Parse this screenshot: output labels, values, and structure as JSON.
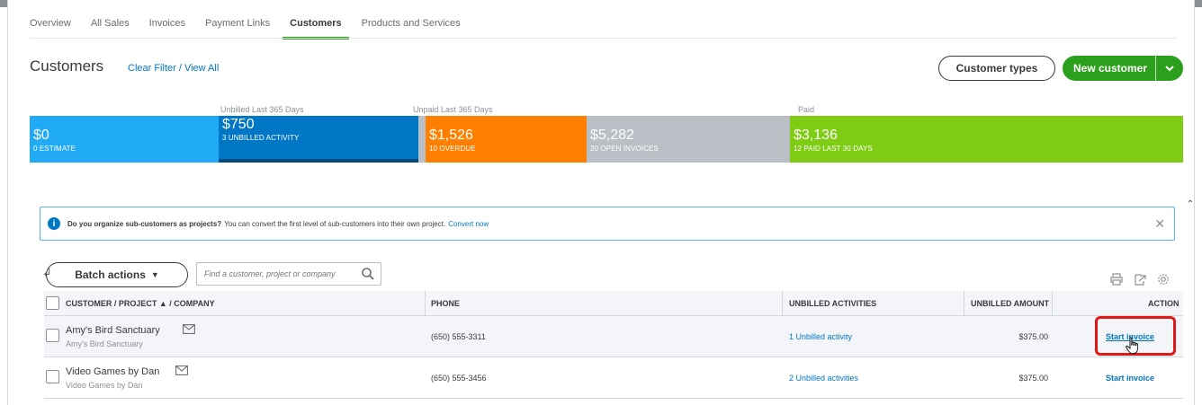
{
  "tabs": [
    "Overview",
    "All Sales",
    "Invoices",
    "Payment Links",
    "Customers",
    "Products and Services"
  ],
  "active_tab": "Customers",
  "header": {
    "title": "Customers",
    "clear_filter": "Clear Filter / View All",
    "customer_types_button": "Customer types",
    "new_customer_button": "New customer"
  },
  "money_bar": {
    "captions": {
      "unbilled": "Unbilled Last 365 Days",
      "unpaid": "Unpaid Last 365 Days",
      "paid": "Paid"
    },
    "segments": {
      "estimate": {
        "amount": "$0",
        "label": "0 ESTIMATE"
      },
      "unbilled": {
        "amount": "$750",
        "label": "3 UNBILLED ACTIVITY"
      },
      "overdue": {
        "amount": "$1,526",
        "label": "10 OVERDUE"
      },
      "open": {
        "amount": "$5,282",
        "label": "20 OPEN INVOICES"
      },
      "paid": {
        "amount": "$3,136",
        "label": "12 PAID LAST 30 DAYS"
      }
    },
    "colors": {
      "estimate": "#21abf6",
      "unbilled": "#0077c5",
      "overdue": "#ff8000",
      "open": "#babec5",
      "paid": "#7fcc14"
    }
  },
  "banner": {
    "bold": "Do you organize sub-customers as projects?",
    "text": "You can convert the first level of sub-customers into their own project.",
    "link": "Convert now"
  },
  "toolbar": {
    "batch_actions": "Batch actions",
    "search_placeholder": "Find a customer, project or company"
  },
  "table": {
    "columns": {
      "customer": "CUSTOMER / PROJECT ▲ / COMPANY",
      "phone": "PHONE",
      "unbilled_activities": "UNBILLED ACTIVITIES",
      "unbilled_amount": "UNBILLED AMOUNT",
      "action": "ACTION"
    },
    "rows": [
      {
        "name": "Amy's Bird Sanctuary",
        "company": "Amy's Bird Sanctuary",
        "phone": "(650) 555-3311",
        "activities": "1 Unbilled activity",
        "amount": "$375.00",
        "action": "Start invoice"
      },
      {
        "name": "Video Games by Dan",
        "company": "Video Games by Dan",
        "phone": "(650) 555-3456",
        "activities": "2 Unbilled activities",
        "amount": "$375.00",
        "action": "Start invoice"
      }
    ]
  },
  "accent_colors": {
    "green": "#2ca01c",
    "link_blue": "#0077c5",
    "highlight_red": "#e01818"
  }
}
